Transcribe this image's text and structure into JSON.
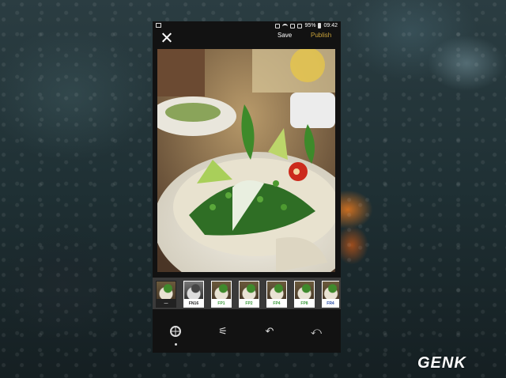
{
  "status_bar": {
    "battery": "95%",
    "time": "09:42"
  },
  "top_bar": {
    "save_label": "Save",
    "publish_label": "Publish"
  },
  "photo": {
    "description_icon": "pho-bowl-image"
  },
  "filters": [
    {
      "label": "—",
      "color": "#dddddd"
    },
    {
      "label": "FN16",
      "color": "#222222"
    },
    {
      "label": "FP1",
      "color": "#3a9a3a"
    },
    {
      "label": "FP2",
      "color": "#3a9a3a"
    },
    {
      "label": "FP4",
      "color": "#3a9a3a"
    },
    {
      "label": "FP8",
      "color": "#3a9a3a"
    },
    {
      "label": "FR4",
      "color": "#2a4fa8"
    }
  ],
  "toolbar": {
    "filters_icon": "aperture-icon",
    "adjust_icon": "sliders-icon",
    "undo_icon": "undo-icon",
    "revert_icon": "revert-icon"
  },
  "watermark": {
    "text": "GENK"
  },
  "colors": {
    "accent_publish": "#c9a23a",
    "background": "#121212"
  }
}
